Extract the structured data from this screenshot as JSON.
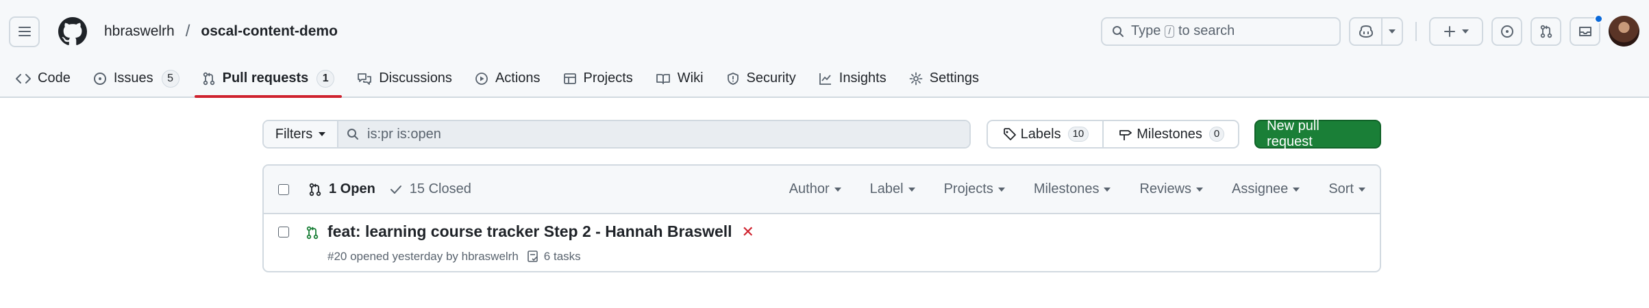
{
  "header": {
    "owner": "hbraswelrh",
    "separator": "/",
    "repo": "oscal-content-demo",
    "search_prefix": "Type",
    "search_key": "/",
    "search_suffix": "to search"
  },
  "tabs": [
    {
      "label": "Code",
      "icon": "code-icon"
    },
    {
      "label": "Issues",
      "icon": "issue-opened-icon",
      "count": "5"
    },
    {
      "label": "Pull requests",
      "icon": "git-pull-request-icon",
      "count": "1",
      "active": true
    },
    {
      "label": "Discussions",
      "icon": "comment-discussion-icon"
    },
    {
      "label": "Actions",
      "icon": "play-icon"
    },
    {
      "label": "Projects",
      "icon": "table-icon"
    },
    {
      "label": "Wiki",
      "icon": "book-icon"
    },
    {
      "label": "Security",
      "icon": "shield-icon"
    },
    {
      "label": "Insights",
      "icon": "graph-icon"
    },
    {
      "label": "Settings",
      "icon": "gear-icon"
    }
  ],
  "toolbar": {
    "filters_label": "Filters",
    "search_value": "is:pr is:open",
    "labels_label": "Labels",
    "labels_count": "10",
    "milestones_label": "Milestones",
    "milestones_count": "0",
    "new_pr_label": "New pull request"
  },
  "list_header": {
    "open_label": "1 Open",
    "closed_label": "15 Closed",
    "sort_menus": [
      "Author",
      "Label",
      "Projects",
      "Milestones",
      "Reviews",
      "Assignee",
      "Sort"
    ]
  },
  "pull_requests": [
    {
      "title": "feat: learning course tracker Step 2 - Hannah Braswell",
      "status_mark": "✕",
      "meta": "#20 opened yesterday by hbraswelrh",
      "tasks": "6 tasks"
    }
  ],
  "colors": {
    "accent_underline": "#cf222e",
    "new_pr_button": "#1a7f37",
    "open_icon": "#1a7f37",
    "fail_mark": "#cf222e",
    "notification_dot": "#0969da"
  }
}
